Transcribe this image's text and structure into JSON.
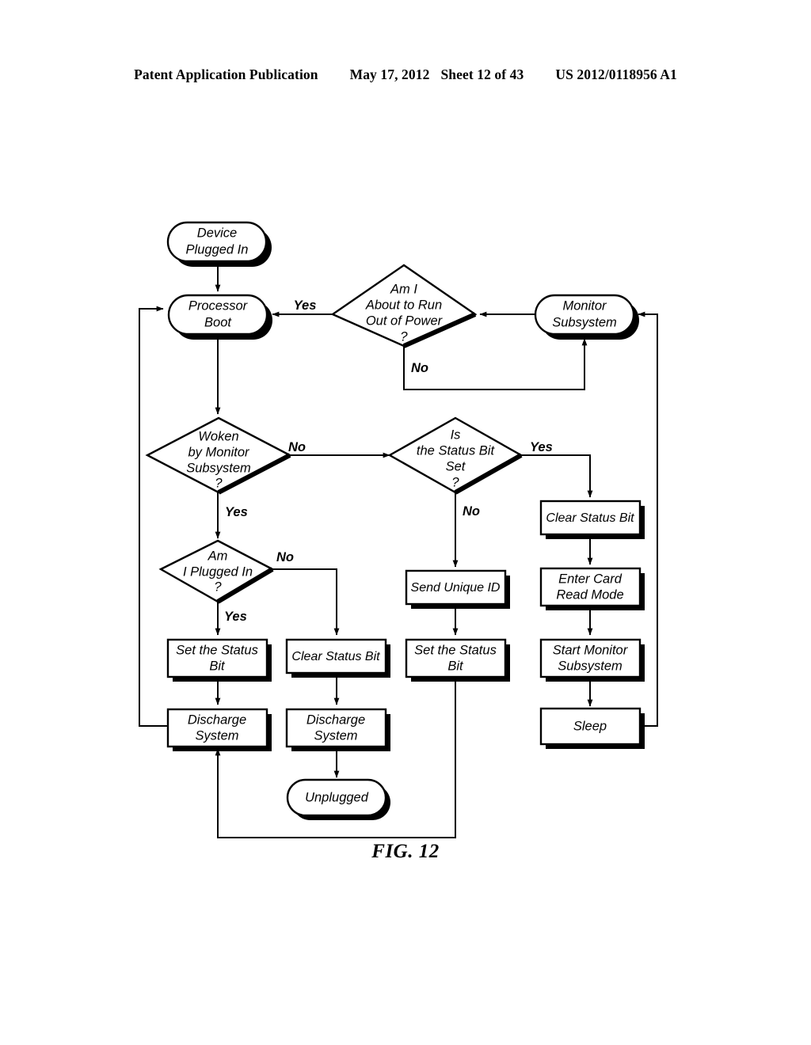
{
  "header": {
    "publication": "Patent Application Publication",
    "date": "May 17, 2012",
    "sheet": "Sheet 12 of 43",
    "patent_number": "US 2012/0118956 A1"
  },
  "figure": {
    "caption": "FIG. 12",
    "type": "flowchart"
  },
  "nodes": {
    "device_plugged_in": {
      "label_line1": "Device",
      "label_line2": "Plugged In",
      "shape": "terminator"
    },
    "processor_boot": {
      "label_line1": "Processor",
      "label_line2": "Boot",
      "shape": "terminator"
    },
    "monitor_subsystem": {
      "label_line1": "Monitor",
      "label_line2": "Subsystem",
      "shape": "terminator"
    },
    "out_of_power": {
      "label_line1": "Am I",
      "label_line2": "About to Run",
      "label_line3": "Out of Power",
      "label_line4": "?",
      "shape": "decision"
    },
    "woken_by_monitor": {
      "label_line1": "Woken",
      "label_line2": "by Monitor",
      "label_line3": "Subsystem",
      "label_line4": "?",
      "shape": "decision"
    },
    "status_bit_set": {
      "label_line1": "Is",
      "label_line2": "the Status Bit",
      "label_line3": "Set",
      "label_line4": "?",
      "shape": "decision"
    },
    "am_i_plugged_in": {
      "label_line1": "Am",
      "label_line2": "I Plugged In",
      "label_line3": "?",
      "shape": "decision"
    },
    "clear_status_bit_right": {
      "label_line1": "Clear Status Bit",
      "shape": "process"
    },
    "enter_card_read_mode": {
      "label_line1": "Enter Card",
      "label_line2": "Read Mode",
      "shape": "process"
    },
    "start_monitor_subsystem": {
      "label_line1": "Start Monitor",
      "label_line2": "Subsystem",
      "shape": "process"
    },
    "sleep": {
      "label_line1": "Sleep",
      "shape": "process"
    },
    "send_unique_id": {
      "label_line1": "Send Unique ID",
      "shape": "process"
    },
    "set_status_bit_mid": {
      "label_line1": "Set the Status",
      "label_line2": "Bit",
      "shape": "process"
    },
    "set_status_bit_left": {
      "label_line1": "Set the Status",
      "label_line2": "Bit",
      "shape": "process"
    },
    "clear_status_bit_mid": {
      "label_line1": "Clear Status Bit",
      "shape": "process"
    },
    "discharge_system_left": {
      "label_line1": "Discharge",
      "label_line2": "System",
      "shape": "process"
    },
    "discharge_system_mid": {
      "label_line1": "Discharge",
      "label_line2": "System",
      "shape": "process"
    },
    "unplugged": {
      "label_line1": "Unplugged",
      "shape": "terminator"
    }
  },
  "edge_labels": {
    "power_yes": "Yes",
    "power_no": "No",
    "woken_no": "No",
    "woken_yes": "Yes",
    "status_yes": "Yes",
    "status_no": "No",
    "plugged_no": "No",
    "plugged_yes": "Yes"
  },
  "colors": {
    "ink": "#000000",
    "paper": "#ffffff"
  }
}
